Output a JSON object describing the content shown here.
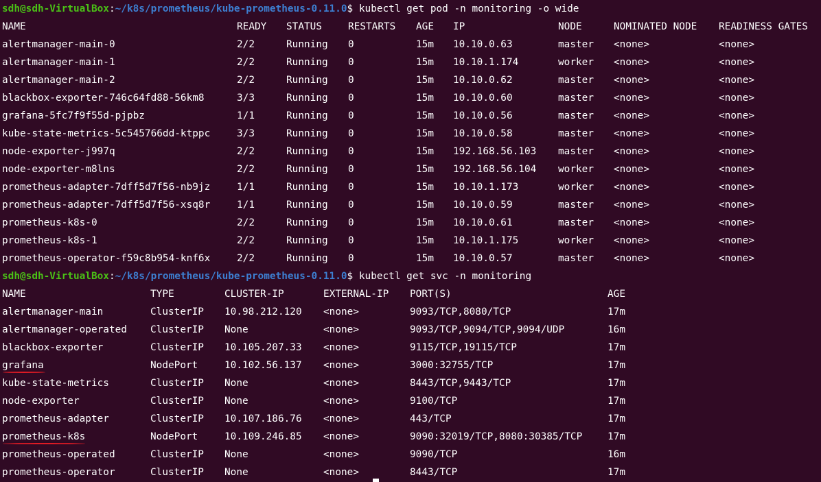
{
  "prompt1": {
    "user_host": "sdh@sdh-VirtualBox",
    "colon": ":",
    "path": "~/k8s/prometheus/kube-prometheus-0.11.0",
    "dollar": "$",
    "command": " kubectl get pod -n monitoring -o wide"
  },
  "pods": {
    "headers": [
      "NAME",
      "READY",
      "STATUS",
      "RESTARTS",
      "AGE",
      "IP",
      "NODE",
      "NOMINATED NODE",
      "READINESS GATES"
    ],
    "rows": [
      [
        "alertmanager-main-0",
        "2/2",
        "Running",
        "0",
        "15m",
        "10.10.0.63",
        "master",
        "<none>",
        "<none>"
      ],
      [
        "alertmanager-main-1",
        "2/2",
        "Running",
        "0",
        "15m",
        "10.10.1.174",
        "worker",
        "<none>",
        "<none>"
      ],
      [
        "alertmanager-main-2",
        "2/2",
        "Running",
        "0",
        "15m",
        "10.10.0.62",
        "master",
        "<none>",
        "<none>"
      ],
      [
        "blackbox-exporter-746c64fd88-56km8",
        "3/3",
        "Running",
        "0",
        "15m",
        "10.10.0.60",
        "master",
        "<none>",
        "<none>"
      ],
      [
        "grafana-5fc7f9f55d-pjpbz",
        "1/1",
        "Running",
        "0",
        "15m",
        "10.10.0.56",
        "master",
        "<none>",
        "<none>"
      ],
      [
        "kube-state-metrics-5c545766dd-ktppc",
        "3/3",
        "Running",
        "0",
        "15m",
        "10.10.0.58",
        "master",
        "<none>",
        "<none>"
      ],
      [
        "node-exporter-j997q",
        "2/2",
        "Running",
        "0",
        "15m",
        "192.168.56.103",
        "master",
        "<none>",
        "<none>"
      ],
      [
        "node-exporter-m8lns",
        "2/2",
        "Running",
        "0",
        "15m",
        "192.168.56.104",
        "worker",
        "<none>",
        "<none>"
      ],
      [
        "prometheus-adapter-7dff5d7f56-nb9jz",
        "1/1",
        "Running",
        "0",
        "15m",
        "10.10.1.173",
        "worker",
        "<none>",
        "<none>"
      ],
      [
        "prometheus-adapter-7dff5d7f56-xsq8r",
        "1/1",
        "Running",
        "0",
        "15m",
        "10.10.0.59",
        "master",
        "<none>",
        "<none>"
      ],
      [
        "prometheus-k8s-0",
        "2/2",
        "Running",
        "0",
        "15m",
        "10.10.0.61",
        "master",
        "<none>",
        "<none>"
      ],
      [
        "prometheus-k8s-1",
        "2/2",
        "Running",
        "0",
        "15m",
        "10.10.1.175",
        "worker",
        "<none>",
        "<none>"
      ],
      [
        "prometheus-operator-f59c8b954-knf6x",
        "2/2",
        "Running",
        "0",
        "15m",
        "10.10.0.57",
        "master",
        "<none>",
        "<none>"
      ]
    ]
  },
  "prompt2": {
    "user_host": "sdh@sdh-VirtualBox",
    "colon": ":",
    "path": "~/k8s/prometheus/kube-prometheus-0.11.0",
    "dollar": "$",
    "command": " kubectl get svc -n monitoring"
  },
  "services": {
    "headers": [
      "NAME",
      "TYPE",
      "CLUSTER-IP",
      "EXTERNAL-IP",
      "PORT(S)",
      "AGE"
    ],
    "rows": [
      [
        "alertmanager-main",
        "ClusterIP",
        "10.98.212.120",
        "<none>",
        "9093/TCP,8080/TCP",
        "17m"
      ],
      [
        "alertmanager-operated",
        "ClusterIP",
        "None",
        "<none>",
        "9093/TCP,9094/TCP,9094/UDP",
        "16m"
      ],
      [
        "blackbox-exporter",
        "ClusterIP",
        "10.105.207.33",
        "<none>",
        "9115/TCP,19115/TCP",
        "17m"
      ],
      [
        "grafana",
        "NodePort",
        "10.102.56.137",
        "<none>",
        "3000:32755/TCP",
        "17m"
      ],
      [
        "kube-state-metrics",
        "ClusterIP",
        "None",
        "<none>",
        "8443/TCP,9443/TCP",
        "17m"
      ],
      [
        "node-exporter",
        "ClusterIP",
        "None",
        "<none>",
        "9100/TCP",
        "17m"
      ],
      [
        "prometheus-adapter",
        "ClusterIP",
        "10.107.186.76",
        "<none>",
        "443/TCP",
        "17m"
      ],
      [
        "prometheus-k8s",
        "NodePort",
        "10.109.246.85",
        "<none>",
        "9090:32019/TCP,8080:30385/TCP",
        "17m"
      ],
      [
        "prometheus-operated",
        "ClusterIP",
        "None",
        "<none>",
        "9090/TCP",
        "16m"
      ],
      [
        "prometheus-operator",
        "ClusterIP",
        "None",
        "<none>",
        "8443/TCP",
        "17m"
      ]
    ]
  },
  "colors": {
    "background": "#300a24",
    "prompt_user": "#4ac016",
    "prompt_path": "#3d7fd1",
    "text": "#ffffff",
    "annotation_underline": "#e01b24"
  },
  "annotations": {
    "underlined_services": [
      "grafana",
      "prometheus-k8s"
    ]
  }
}
